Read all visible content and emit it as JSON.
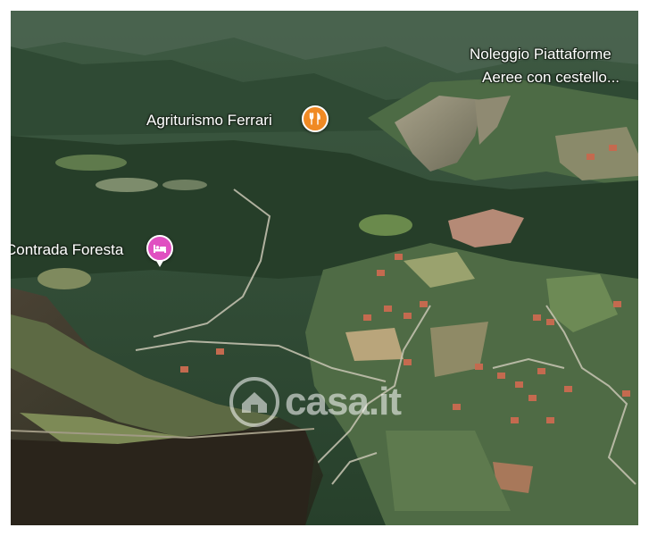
{
  "map": {
    "pois": [
      {
        "id": "agriturismo",
        "label": "Agriturismo Ferrari",
        "category": "restaurant",
        "icon": "fork-knife-icon",
        "color": "#f08a24"
      },
      {
        "id": "contrada",
        "label": "Contrada Foresta",
        "category": "hotel",
        "icon": "bed-icon",
        "color": "#e04fc1"
      },
      {
        "id": "noleggio",
        "label_line1": "Noleggio Piattaforme",
        "label_line2": "Aeree con cestello..."
      }
    ],
    "watermark": {
      "text": "casa.it",
      "icon": "house-logo-icon"
    }
  }
}
